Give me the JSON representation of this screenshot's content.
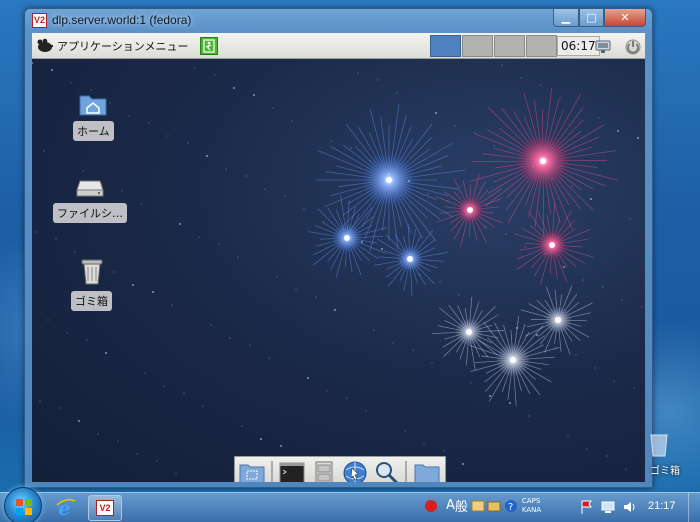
{
  "window": {
    "title": "dlp.server.world:1 (fedora)",
    "icon_label": "V2",
    "icon_name": "vnc-icon",
    "controls": {
      "minimize": "▁",
      "maximize": "□",
      "close": "✕"
    }
  },
  "xfce_panel": {
    "menu_label": "アプリケーションメニュー",
    "workspaces": [
      {
        "active": true
      },
      {
        "active": false
      },
      {
        "active": false
      },
      {
        "active": false
      }
    ],
    "clock": "06:17"
  },
  "desktop_icons": [
    {
      "label": "ホーム",
      "icon": "home-folder-icon"
    },
    {
      "label": "ファイルシ…",
      "icon": "drive-icon"
    },
    {
      "label": "ゴミ箱",
      "icon": "trash-icon"
    }
  ],
  "dock": [
    "file-manager-icon",
    "terminal-icon",
    "file-cabinet-icon",
    "web-browser-icon",
    "search-icon",
    "folder-icon"
  ],
  "taskbar": {
    "ime_mode": "A",
    "ime_conv": "般",
    "caps": "CAPS",
    "kana": "KANA",
    "clock": "21:17",
    "vnc_label": "V2"
  },
  "recycle_peek_label": "ゴミ箱",
  "colors": {
    "workspace_active": "#4f80bf",
    "panel_bg": "#e8e8e6",
    "desktop_bg": "#1b2a4a",
    "taskbar": "#3c6eaa"
  }
}
